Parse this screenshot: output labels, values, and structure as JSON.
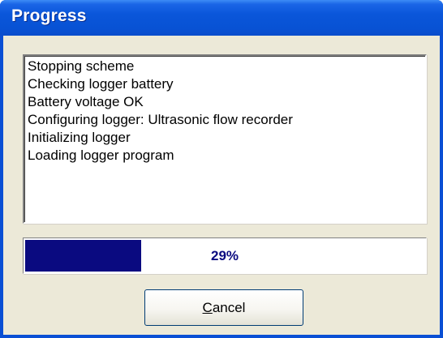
{
  "window": {
    "title": "Progress"
  },
  "log": {
    "lines": [
      "Stopping scheme",
      "Checking logger battery",
      "Battery voltage OK",
      "Configuring logger: Ultrasonic flow recorder",
      "Initializing logger",
      "Loading logger program"
    ]
  },
  "progress": {
    "percent": 29,
    "label": "29%",
    "bar_color": "#0a0a80"
  },
  "buttons": {
    "cancel_mnemonic": "C",
    "cancel_rest": "ancel"
  },
  "colors": {
    "titlebar": "#0a56da",
    "dialog_face": "#ece9d8"
  }
}
